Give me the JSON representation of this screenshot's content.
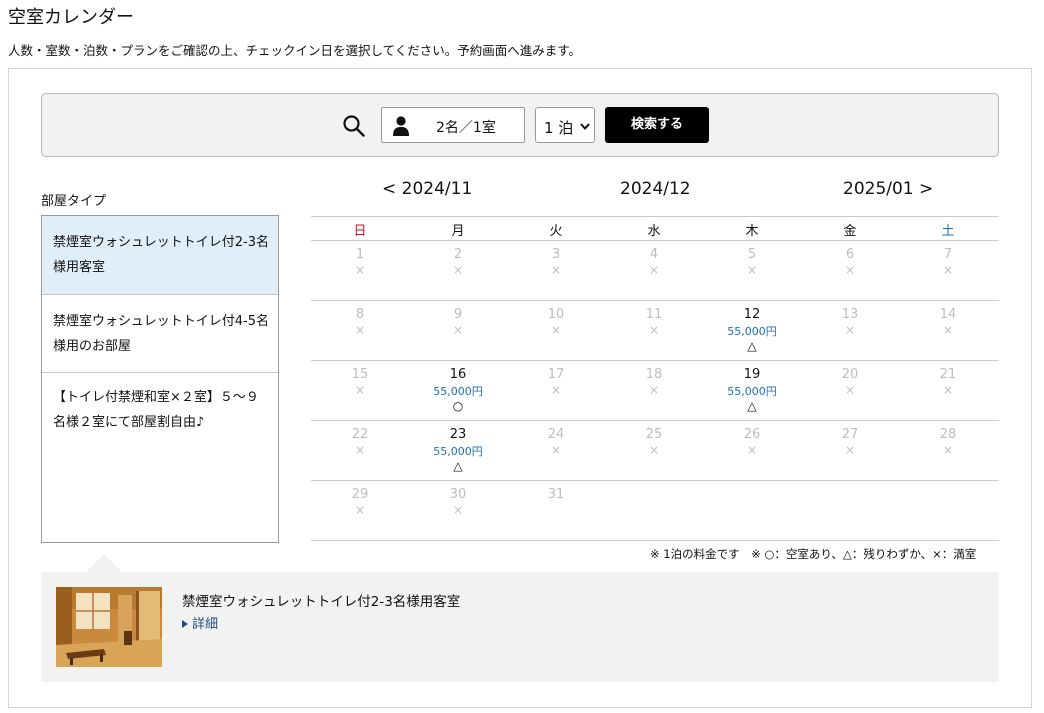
{
  "page": {
    "title": "空室カレンダー",
    "description": "人数・室数・泊数・プランをご確認の上、チェックイン日を選択してください。予約画面へ進みます。"
  },
  "search": {
    "guests_rooms": "2名／1室",
    "nights_selected": "1 泊",
    "search_button": "検索する"
  },
  "rooms": {
    "label": "部屋タイプ",
    "items": [
      {
        "name": "禁煙室ウォシュレットトイレ付2-3名様用客室",
        "active": true
      },
      {
        "name": "禁煙室ウォシュレットトイレ付4-5名様用のお部屋",
        "active": false
      },
      {
        "name": "【トイレ付禁煙和室×２室】５～９名様２室にて部屋割自由♪",
        "active": false
      }
    ]
  },
  "detail": {
    "title": "禁煙室ウォシュレットトイレ付2-3名様用客室",
    "link": "詳細"
  },
  "calendar": {
    "prev_month": "< 2024/11",
    "current_month": "2024/12",
    "next_month": "2025/01 >",
    "weekdays": [
      "日",
      "月",
      "火",
      "水",
      "木",
      "金",
      "土"
    ],
    "weeks": [
      [
        {
          "d": "1",
          "s": "×"
        },
        {
          "d": "2",
          "s": "×"
        },
        {
          "d": "3",
          "s": "×"
        },
        {
          "d": "4",
          "s": "×"
        },
        {
          "d": "5",
          "s": "×"
        },
        {
          "d": "6",
          "s": "×"
        },
        {
          "d": "7",
          "s": "×"
        }
      ],
      [
        {
          "d": "8",
          "s": "×"
        },
        {
          "d": "9",
          "s": "×"
        },
        {
          "d": "10",
          "s": "×"
        },
        {
          "d": "11",
          "s": "×"
        },
        {
          "d": "12",
          "p": "55,000円",
          "s": "△"
        },
        {
          "d": "13",
          "s": "×"
        },
        {
          "d": "14",
          "s": "×"
        }
      ],
      [
        {
          "d": "15",
          "s": "×"
        },
        {
          "d": "16",
          "p": "55,000円",
          "s": "○"
        },
        {
          "d": "17",
          "s": "×"
        },
        {
          "d": "18",
          "s": "×"
        },
        {
          "d": "19",
          "p": "55,000円",
          "s": "△"
        },
        {
          "d": "20",
          "s": "×"
        },
        {
          "d": "21",
          "s": "×"
        }
      ],
      [
        {
          "d": "22",
          "s": "×"
        },
        {
          "d": "23",
          "p": "55,000円",
          "s": "△"
        },
        {
          "d": "24",
          "s": "×"
        },
        {
          "d": "25",
          "s": "×"
        },
        {
          "d": "26",
          "s": "×"
        },
        {
          "d": "27",
          "s": "×"
        },
        {
          "d": "28",
          "s": "×"
        }
      ],
      [
        {
          "d": "29",
          "s": "×"
        },
        {
          "d": "30",
          "s": "×"
        },
        {
          "d": "31",
          "s": ""
        },
        null,
        null,
        null,
        null
      ]
    ],
    "legend": "※ 1泊の料金です　※ ○：空室あり、△：残りわずか、×：満室"
  },
  "colors": {
    "sunday": "#c8102e",
    "saturday": "#1d6fb8",
    "price": "#1d6fb8",
    "active_room": "#dfeef8",
    "button": "#000000"
  },
  "icons": [
    "search-icon",
    "person-icon",
    "chevron-down-icon",
    "triangle-right-icon"
  ]
}
